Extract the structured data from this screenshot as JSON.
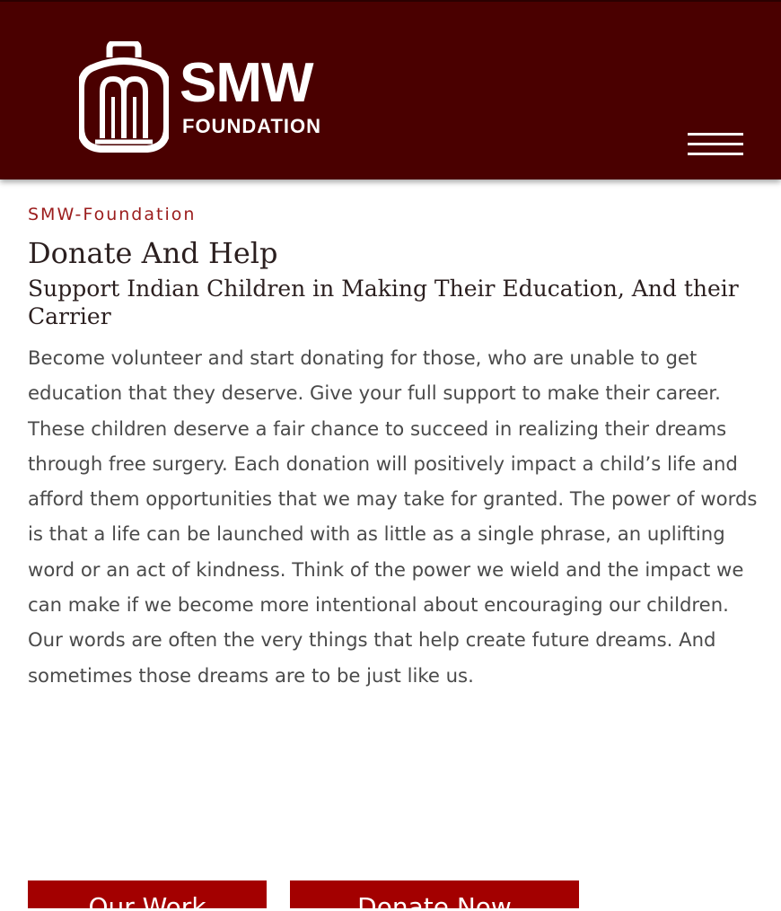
{
  "header": {
    "logo": {
      "name": "SMW",
      "subname": "FOUNDATION",
      "icon": "foundation-logo-icon"
    },
    "menu_icon": "hamburger-menu-icon"
  },
  "main": {
    "eyebrow": "SMW-Foundation",
    "title": "Donate And Help",
    "subtitle": "Support Indian Children in Making Their Education, And their Carrier",
    "body": "Become volunteer and start donating for those, who are unable to get education that they deserve. Give your full support to make their career. These children deserve a fair chance to succeed in realizing their dreams through free surgery. Each donation will positively impact a child’s life and afford them opportunities that we may take for granted. The power of words is that a life can be launched with as little as a single phrase, an uplifting word or an act of kindness. Think of the power we wield and the impact we can make if we become more intentional about encouraging our children. Our words are often the very things that help create future dreams. And sometimes those dreams are to be just like us."
  },
  "buttons": {
    "our_work": "Our Work",
    "donate_now": "Donate Now"
  },
  "colors": {
    "header_bg": "#4a0000",
    "accent": "#9b1c1c",
    "button_bg": "#a30000",
    "text": "#4a4a4a",
    "heading": "#2b1f1f"
  }
}
